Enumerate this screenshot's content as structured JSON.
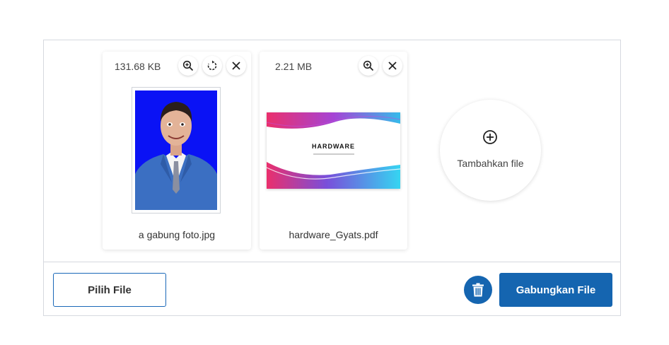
{
  "files": [
    {
      "size": "131.68 KB",
      "name": "a gabung foto.jpg",
      "actions": [
        "zoom-in-icon",
        "rotate-icon",
        "close-icon"
      ]
    },
    {
      "size": "2.21 MB",
      "name": "hardware_Gyats.pdf",
      "actions": [
        "zoom-in-icon",
        "close-icon"
      ]
    }
  ],
  "pdf_preview": {
    "title": "HARDWARE"
  },
  "add_file": {
    "label": "Tambahkan file"
  },
  "toolbar": {
    "pick_label": "Pilih File",
    "merge_label": "Gabungkan File"
  },
  "colors": {
    "accent": "#1565b0",
    "photo_bg": "#0a12f5"
  }
}
